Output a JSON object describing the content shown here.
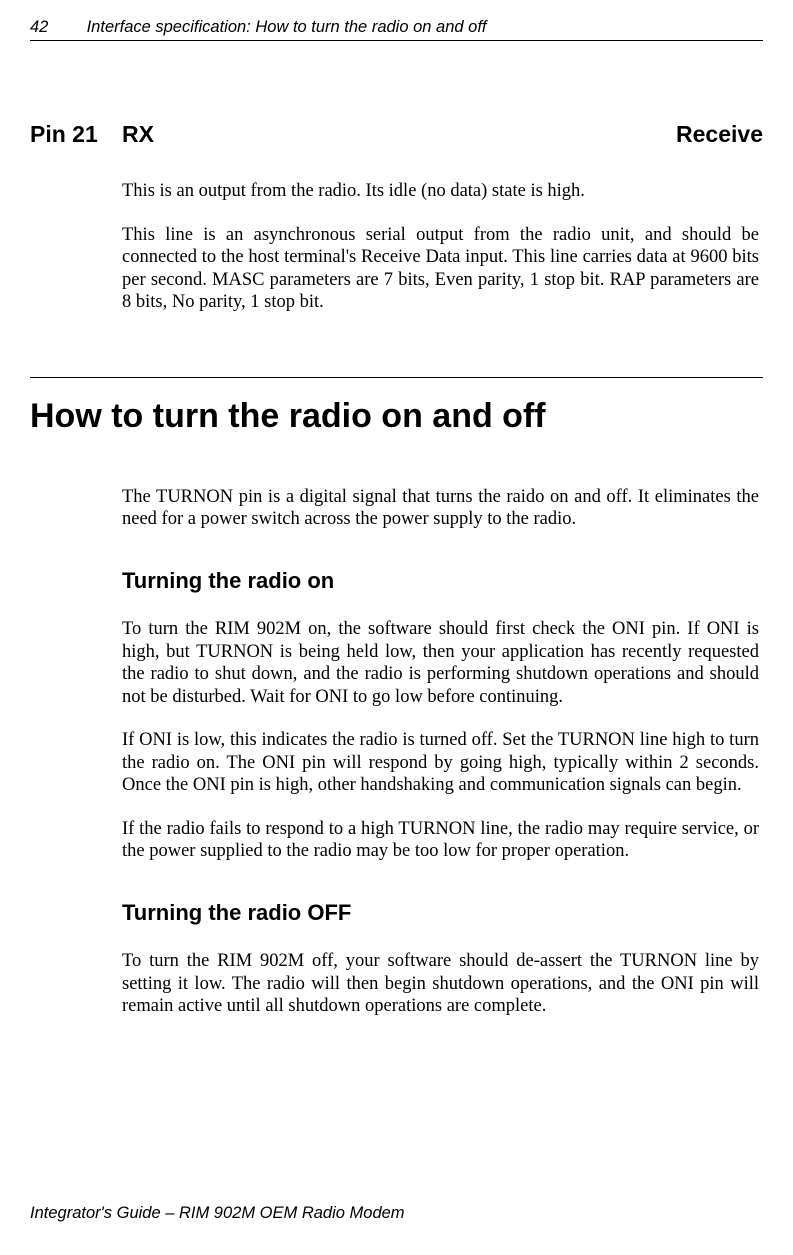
{
  "header": {
    "page_num": "42",
    "title": "Interface specification:  How to turn the radio on and off"
  },
  "pin": {
    "id": "Pin 21",
    "short": "RX",
    "long": "Receive",
    "para1": "This is an output from the radio. Its idle (no data) state is high.",
    "para2": "This line is an asynchronous serial output from the radio unit, and should be connected to the host terminal's Receive Data input. This line carries data at 9600 bits per second. MASC parameters are 7 bits, Even parity, 1 stop bit. RAP parameters are 8 bits, No parity, 1 stop bit."
  },
  "section": {
    "title": "How to turn the radio on and off",
    "intro": "The TURNON pin is a digital signal that turns the raido on and off. It eliminates the need for a power switch across the power supply to the radio.",
    "sub1": {
      "title": "Turning the radio on",
      "p1": "To turn the RIM 902M on, the software should first check the ONI pin. If ONI is high, but TURNON is being held low, then your application has recently requested the radio to shut down, and the radio is performing shutdown operations and should not be disturbed. Wait for ONI to go low before continuing.",
      "p2": "If ONI is low, this indicates the radio is turned off. Set the TURNON line high to turn the radio on. The ONI pin will respond by going high, typically within 2 seconds. Once the ONI pin is high, other handshaking and communication signals can begin.",
      "p3": "If the radio fails to respond to a high TURNON line, the radio may require service, or the power supplied to the radio may be too low for proper operation."
    },
    "sub2": {
      "title": "Turning the radio OFF",
      "p1": "To turn the RIM 902M off, your software should de-assert the TURNON line by setting it low. The radio will then begin shutdown operations, and the ONI pin will remain active until all shutdown operations are complete."
    }
  },
  "footer": "Integrator's Guide – RIM 902M OEM Radio Modem"
}
